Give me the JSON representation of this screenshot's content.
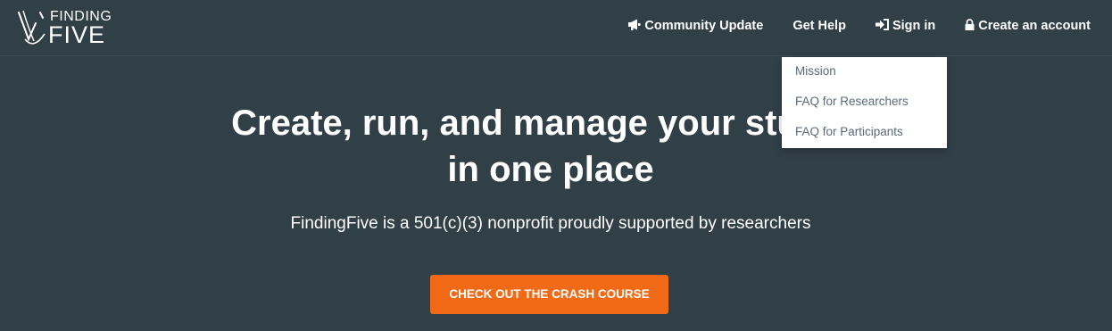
{
  "brand": {
    "logo_top": "FINDING",
    "logo_bottom": "FIVE"
  },
  "nav": {
    "community_update": "Community Update",
    "get_help": "Get Help",
    "sign_in": "Sign in",
    "create_account": "Create an account"
  },
  "dropdown": {
    "items": [
      {
        "label": "Mission"
      },
      {
        "label": "FAQ for Researchers"
      },
      {
        "label": "FAQ for Participants"
      }
    ]
  },
  "hero": {
    "title_line1": "Create, run, and manage your studies",
    "title_line2": "in one place",
    "subtitle": "FindingFive is a 501(c)(3) nonprofit proudly supported by researchers",
    "cta_label": "CHECK OUT THE CRASH COURSE"
  },
  "colors": {
    "background": "#313f47",
    "accent": "#f26a15",
    "dropdown_text": "#5a6a7a"
  },
  "icons": {
    "community_update": "megaphone-icon",
    "sign_in": "sign-in-icon",
    "create_account": "lock-icon"
  }
}
